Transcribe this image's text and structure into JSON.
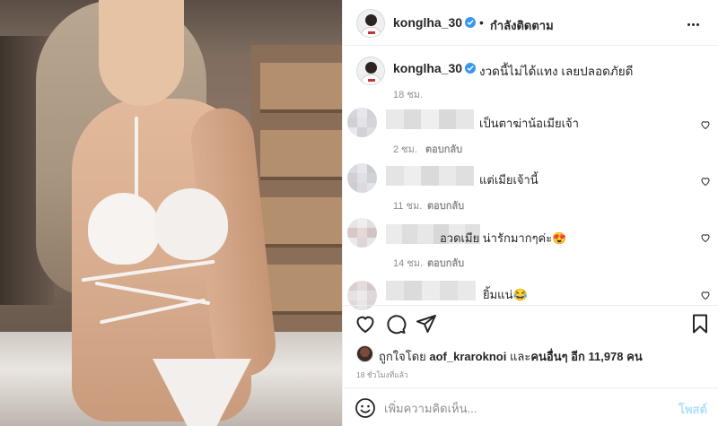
{
  "header": {
    "username": "konglha_30",
    "separator": "•",
    "follow_status": "กำลังติดตาม"
  },
  "caption": {
    "username": "konglha_30",
    "text": "งวดนี้ไม่ได้แทง เลยปลอดภัยดี",
    "time": "18 ชม."
  },
  "comments": [
    {
      "text": "เป็นตาฆ่าน้อเมียเจ้า",
      "time": "2 ชม.",
      "reply": "ตอบกลับ"
    },
    {
      "text": "แต่เมียเจ้านี้",
      "time": "11 ชม.",
      "reply": "ตอบกลับ"
    },
    {
      "text": "อวดเมีย น่ารักมากๆค่ะ😍",
      "time": "14 ชม.",
      "reply": "ตอบกลับ"
    },
    {
      "text": "ยิ้มแน่😂",
      "time": "",
      "reply": ""
    }
  ],
  "likes": {
    "prefix": "ถูกใจโดย",
    "user": "aof_kraroknoi",
    "middle": "และ",
    "others": "คนอื่นๆ อีก 11,978 คน"
  },
  "time_ago": "18 ชั่วโมงที่แล้ว",
  "composer": {
    "placeholder": "เพิ่มความคิดเห็น...",
    "post_label": "โพสต์"
  },
  "icons": {
    "like": "heart-icon",
    "comment": "comment-icon",
    "share": "share-icon",
    "save": "bookmark-icon",
    "emoji": "emoji-icon",
    "more": "more-icon",
    "verified": "verified-badge-icon"
  },
  "colors": {
    "verified": "#3897f0",
    "post_button": "#b2dffc",
    "secondary_text": "#8e8e8e",
    "primary_text": "#262626"
  }
}
